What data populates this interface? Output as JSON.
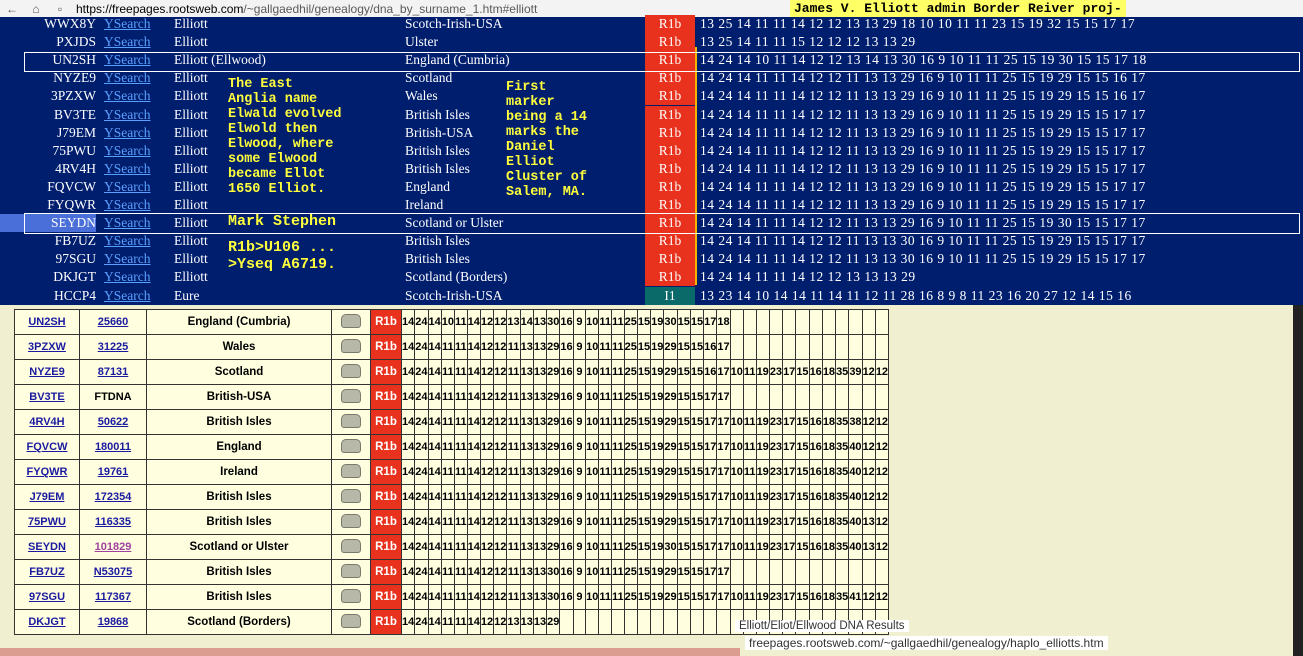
{
  "browser": {
    "url_host": "https://freepages.rootsweb.com",
    "url_path": "/~gallgaedhil/genealogy/dna_by_surname_1.htm#elliott",
    "header_title": "James V. Elliott admin Border Reiver proj-"
  },
  "ysearch_label": "YSearch",
  "top_rows": [
    {
      "kit": "WWX8Y",
      "surname": "Elliott",
      "origin": "Scotch-Irish-USA",
      "haplo": "R1b",
      "strs": "13 25 14 11 11 14 12 12 13 13 29 18 10 10 11 11 23 15 19 32 15 15 17 17"
    },
    {
      "kit": "PXJDS",
      "surname": "Elliott",
      "origin": "Ulster",
      "haplo": "R1b",
      "strs": "13 25 14 11 11 15 12 12 12 13 13 29"
    },
    {
      "kit": "UN2SH",
      "surname": "Elliott (Ellwood)",
      "origin": "England (Cumbria)",
      "haplo": "R1b",
      "strs": "14 24 14 10 11 14 12 12 13 14 13 30 16  9 10 11 11 25 15 19 30 15 15 17 18"
    },
    {
      "kit": "NYZE9",
      "surname": "Elliott",
      "origin": "Scotland",
      "haplo": "R1b",
      "strs": "14 24 14 11 11 14 12 12 11 13 13 29 16  9 10 11 11 25 15 19 29 15 15 16 17"
    },
    {
      "kit": "3PZXW",
      "surname": "Elliott",
      "origin": "Wales",
      "haplo": "R1b",
      "strs": "14 24 14 11 11 14 12 12 11 13 13 29 16  9 10 11 11 25 15 19 29 15 15 16 17"
    },
    {
      "kit": "BV3TE",
      "surname": "Elliott",
      "origin": "British Isles",
      "haplo": "R1b",
      "strs": "14 24 14 11 11 14 12 12 11 13 13 29 16  9 10 11 11 25 15 19 29 15 15 17 17"
    },
    {
      "kit": "J79EM",
      "surname": "Elliott",
      "origin": "British-USA",
      "haplo": "R1b",
      "strs": "14 24 14 11 11 14 12 12 11 13 13 29 16  9 10 11 11 25 15 19 29 15 15 17 17"
    },
    {
      "kit": "75PWU",
      "surname": "Elliott",
      "origin": "British Isles",
      "haplo": "R1b",
      "strs": "14 24 14 11 11 14 12 12 11 13 13 29 16  9 10 11 11 25 15 19 29 15 15 17 17"
    },
    {
      "kit": "4RV4H",
      "surname": "Elliott",
      "origin": "British Isles",
      "haplo": "R1b",
      "strs": "14 24 14 11 11 14 12 12 11 13 13 29 16  9 10 11 11 25 15 19 29 15 15 17 17"
    },
    {
      "kit": "FQVCW",
      "surname": "Elliott",
      "origin": "England",
      "haplo": "R1b",
      "strs": "14 24 14 11 11 14 12 12 11 13 13 29 16  9 10 11 11 25 15 19 29 15 15 17 17"
    },
    {
      "kit": "FYQWR",
      "surname": "Elliott",
      "origin": "Ireland",
      "haplo": "R1b",
      "strs": "14 24 14 11 11 14 12 12 11 13 13 29 16  9 10 11 11 25 15 19 29 15 15 17 17"
    },
    {
      "kit": "SEYDN",
      "surname": "Elliott",
      "origin": "Scotland or Ulster",
      "haplo": "R1b",
      "strs": "14 24 14 11 11 14 12 12 11 13 13 29 16  9 10 11 11 25 15 19 30 15 15 17 17"
    },
    {
      "kit": "FB7UZ",
      "surname": "Elliott",
      "origin": "British Isles",
      "haplo": "R1b",
      "strs": "14 24 14 11 11 14 12 12 11 13 13 30 16  9 10 11 11 25 15 19 29 15 15 17 17"
    },
    {
      "kit": "97SGU",
      "surname": "Elliott",
      "origin": "British Isles",
      "haplo": "R1b",
      "strs": "14 24 14 11 11 14 12 12 11 13 13 30 16  9 10 11 11 25 15 19 29 15 15 17 17"
    },
    {
      "kit": "DKJGT",
      "surname": "Elliott",
      "origin": "Scotland (Borders)",
      "haplo": "R1b",
      "strs": "14 24 14 11 11 14 12 12 13 13 13 29"
    },
    {
      "kit": "HCCP4",
      "surname": "Eure",
      "origin": "Scotch-Irish-USA",
      "haplo": "I1",
      "strs": "13 23 14 10 14 14 11 14 11 12 11 28 16  8  9  8 11 23 16 20 27 12 14 15 16"
    }
  ],
  "notes": {
    "east_anglia": "The East\nAnglia name\nElwald evolved\nElwold then\nElwood, where\nsome Elwood\nbecame Ellot\n1650 Elliot.",
    "first_marker": "First\nmarker\nbeing a 14\nmarks the\nDaniel\nElliot\nCluster of\nSalem, MA.",
    "mark_stephen": "Mark Stephen",
    "snp": "R1b>U106 ...\n>Yseq A6719."
  },
  "bottom_rows": [
    {
      "kit": "UN2SH",
      "ys": "25660",
      "origin": "England (Cumbria)",
      "haplo": "R1b",
      "v": [
        "14",
        "24",
        "14",
        "10",
        "11",
        "14",
        "12",
        "12",
        "13",
        "14",
        "13",
        "30",
        "16",
        "9",
        "10",
        "11",
        "11",
        "25",
        "15",
        "19",
        "30",
        "15",
        "15",
        "17",
        "18",
        "",
        "",
        "",
        "",
        "",
        "",
        "",
        "",
        "",
        "",
        "",
        "",
        ""
      ]
    },
    {
      "kit": "3PZXW",
      "ys": "31225",
      "origin": "Wales",
      "haplo": "R1b",
      "v": [
        "14",
        "24",
        "14",
        "11",
        "11",
        "14",
        "12",
        "12",
        "11",
        "13",
        "13",
        "29",
        "16",
        "9",
        "10",
        "11",
        "11",
        "25",
        "15",
        "19",
        "29",
        "15",
        "15",
        "16",
        "17",
        "",
        "",
        "",
        "",
        "",
        "",
        "",
        "",
        "",
        "",
        "",
        "",
        ""
      ]
    },
    {
      "kit": "NYZE9",
      "ys": "87131",
      "origin": "Scotland",
      "haplo": "R1b",
      "v": [
        "14",
        "24",
        "14",
        "11",
        "11",
        "14",
        "12",
        "12",
        "11",
        "13",
        "13",
        "29",
        "16",
        "9",
        "10",
        "11",
        "11",
        "25",
        "15",
        "19",
        "29",
        "15",
        "15",
        "16",
        "17",
        "10",
        "11",
        "19",
        "23",
        "17",
        "15",
        "16",
        "18",
        "35",
        "39",
        "12",
        "12"
      ]
    },
    {
      "kit": "BV3TE",
      "ys": "FTDNA",
      "origin": "British-USA",
      "haplo": "R1b",
      "plain": true,
      "v": [
        "14",
        "24",
        "14",
        "11",
        "11",
        "14",
        "12",
        "12",
        "11",
        "13",
        "13",
        "29",
        "16",
        "9",
        "10",
        "11",
        "11",
        "25",
        "15",
        "19",
        "29",
        "15",
        "15",
        "17",
        "17",
        "",
        "",
        "",
        "",
        "",
        "",
        "",
        "",
        "",
        "",
        "",
        ""
      ]
    },
    {
      "kit": "4RV4H",
      "ys": "50622",
      "origin": "British Isles",
      "haplo": "R1b",
      "v": [
        "14",
        "24",
        "14",
        "11",
        "11",
        "14",
        "12",
        "12",
        "11",
        "13",
        "13",
        "29",
        "16",
        "9",
        "10",
        "11",
        "11",
        "25",
        "15",
        "19",
        "29",
        "15",
        "15",
        "17",
        "17",
        "10",
        "11",
        "19",
        "23",
        "17",
        "15",
        "16",
        "18",
        "35",
        "38",
        "12",
        "12"
      ]
    },
    {
      "kit": "FQVCW",
      "ys": "180011",
      "origin": "England",
      "haplo": "R1b",
      "v": [
        "14",
        "24",
        "14",
        "11",
        "11",
        "14",
        "12",
        "12",
        "11",
        "13",
        "13",
        "29",
        "16",
        "9",
        "10",
        "11",
        "11",
        "25",
        "15",
        "19",
        "29",
        "15",
        "15",
        "17",
        "17",
        "10",
        "11",
        "19",
        "23",
        "17",
        "15",
        "16",
        "18",
        "35",
        "40",
        "12",
        "12"
      ]
    },
    {
      "kit": "FYQWR",
      "ys": "19761",
      "origin": "Ireland",
      "haplo": "R1b",
      "v": [
        "14",
        "24",
        "14",
        "11",
        "11",
        "14",
        "12",
        "12",
        "11",
        "13",
        "13",
        "29",
        "16",
        "9",
        "10",
        "11",
        "11",
        "25",
        "15",
        "19",
        "29",
        "15",
        "15",
        "17",
        "17",
        "10",
        "11",
        "19",
        "23",
        "17",
        "15",
        "16",
        "18",
        "35",
        "40",
        "12",
        "12"
      ]
    },
    {
      "kit": "J79EM",
      "ys": "172354",
      "origin": "British Isles",
      "haplo": "R1b",
      "v": [
        "14",
        "24",
        "14",
        "11",
        "11",
        "14",
        "12",
        "12",
        "11",
        "13",
        "13",
        "29",
        "16",
        "9",
        "10",
        "11",
        "11",
        "25",
        "15",
        "19",
        "29",
        "15",
        "15",
        "17",
        "17",
        "10",
        "11",
        "19",
        "23",
        "17",
        "15",
        "16",
        "18",
        "35",
        "40",
        "12",
        "12"
      ]
    },
    {
      "kit": "75PWU",
      "ys": "116335",
      "origin": "British Isles",
      "haplo": "R1b",
      "v": [
        "14",
        "24",
        "14",
        "11",
        "11",
        "14",
        "12",
        "12",
        "11",
        "13",
        "13",
        "29",
        "16",
        "9",
        "10",
        "11",
        "11",
        "25",
        "15",
        "19",
        "29",
        "15",
        "15",
        "17",
        "17",
        "10",
        "11",
        "19",
        "23",
        "17",
        "15",
        "16",
        "18",
        "35",
        "40",
        "13",
        "12"
      ]
    },
    {
      "kit": "SEYDN",
      "ys": "101829",
      "origin": "Scotland or Ulster",
      "haplo": "R1b",
      "visited": true,
      "v": [
        "14",
        "24",
        "14",
        "11",
        "11",
        "14",
        "12",
        "12",
        "11",
        "13",
        "13",
        "29",
        "16",
        "9",
        "10",
        "11",
        "11",
        "25",
        "15",
        "19",
        "30",
        "15",
        "15",
        "17",
        "17",
        "10",
        "11",
        "19",
        "23",
        "17",
        "15",
        "16",
        "18",
        "35",
        "40",
        "13",
        "12"
      ]
    },
    {
      "kit": "FB7UZ",
      "ys": "N53075",
      "origin": "British Isles",
      "haplo": "R1b",
      "v": [
        "14",
        "24",
        "14",
        "11",
        "11",
        "14",
        "12",
        "12",
        "11",
        "13",
        "13",
        "30",
        "16",
        "9",
        "10",
        "11",
        "11",
        "25",
        "15",
        "19",
        "29",
        "15",
        "15",
        "17",
        "17",
        "",
        "",
        "",
        "",
        "",
        "",
        "",
        "",
        "",
        "",
        "",
        ""
      ]
    },
    {
      "kit": "97SGU",
      "ys": "117367",
      "origin": "British Isles",
      "haplo": "R1b",
      "v": [
        "14",
        "24",
        "14",
        "11",
        "11",
        "14",
        "12",
        "12",
        "11",
        "13",
        "13",
        "30",
        "16",
        "9",
        "10",
        "11",
        "11",
        "25",
        "15",
        "19",
        "29",
        "15",
        "15",
        "17",
        "17",
        "10",
        "11",
        "19",
        "23",
        "17",
        "15",
        "16",
        "18",
        "35",
        "41",
        "12",
        "12"
      ]
    },
    {
      "kit": "DKJGT",
      "ys": "19868",
      "origin": "Scotland (Borders)",
      "haplo": "R1b",
      "v": [
        "14",
        "24",
        "14",
        "11",
        "11",
        "14",
        "12",
        "12",
        "13",
        "13",
        "13",
        "29",
        "",
        "",
        "",
        "",
        "",
        "",
        "",
        "",
        "",
        "",
        "",
        "",
        "",
        "",
        "",
        "",
        "",
        "",
        "",
        "",
        "",
        "",
        "",
        "",
        ""
      ]
    }
  ],
  "footer": {
    "title": "Elliott/Eliot/Ellwood DNA Results",
    "url": "freepages.rootsweb.com/~gallgaedhil/genealogy/haplo_elliotts.htm"
  }
}
